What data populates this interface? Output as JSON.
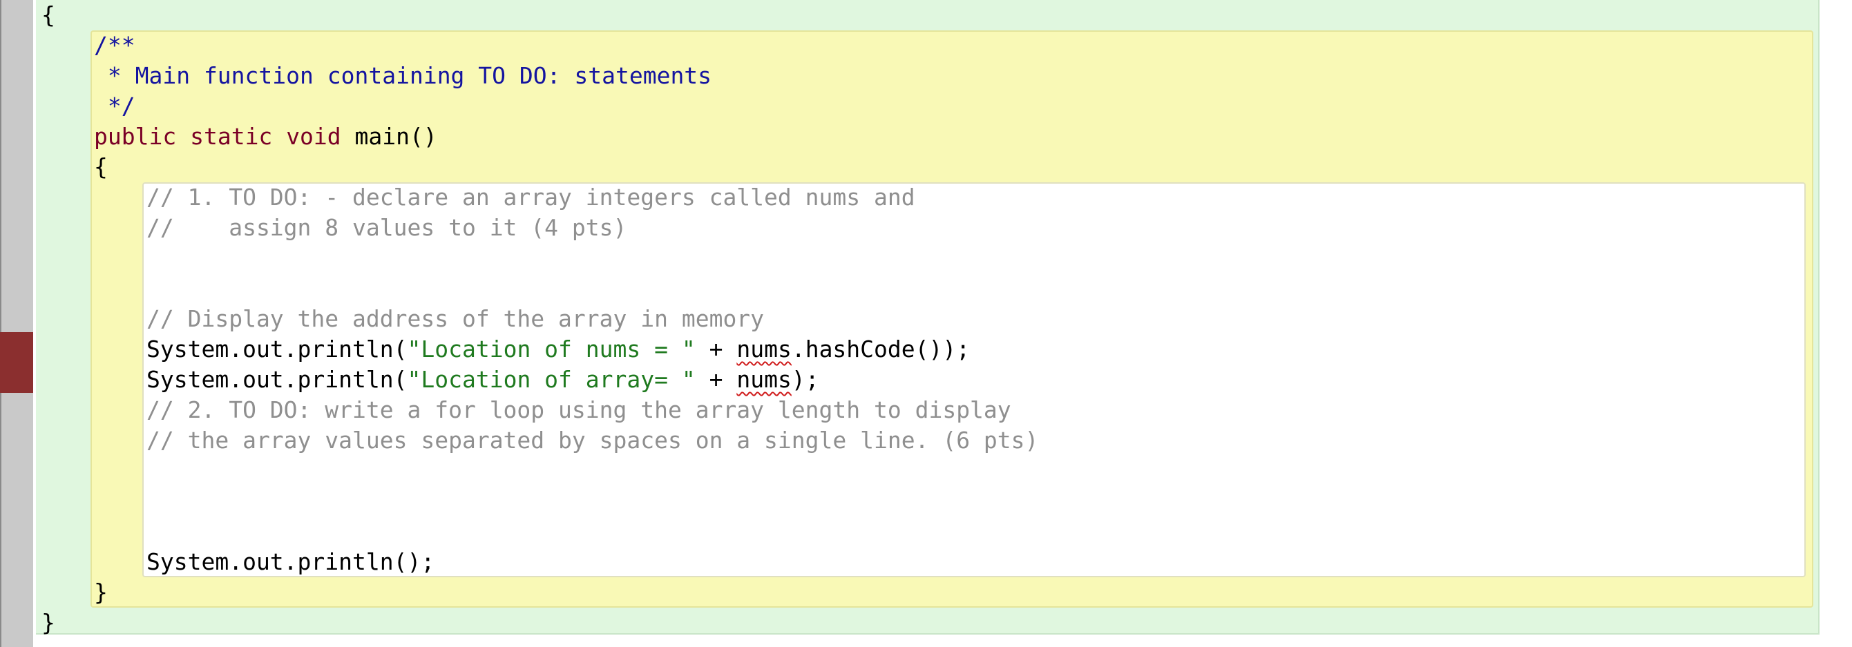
{
  "colors": {
    "class_scope_bg": "#e0f7df",
    "method_scope_bg": "#f9f9b6",
    "body_scope_bg": "#ffffff",
    "gutter_bg": "#c9c9c9",
    "gutter_marker": "#8b2f2f",
    "comment": "#8f8f8f",
    "javadoc": "#1414a0",
    "keyword": "#7a0026",
    "string": "#1f7a1f",
    "error_underline": "#d01c1c"
  },
  "code": {
    "class_open": "{",
    "javadoc_open": "/**",
    "javadoc_text": " * Main function containing TO DO: statements",
    "javadoc_close": " */",
    "sig_public": "public",
    "sig_static": "static",
    "sig_void": "void",
    "sig_rest": " main()",
    "method_open": "{",
    "comment_todo1_a": "// 1. TO DO: - declare an array integers called nums and",
    "comment_todo1_b": "//    assign 8 values to it (4 pts)",
    "comment_display": "// Display the address of the array in memory",
    "print1_prefix": "System.out.println(",
    "print1_string": "\"Location of nums = \"",
    "print1_plus": " + ",
    "print1_var": "nums",
    "print1_suffix": ".hashCode());",
    "print2_prefix": "System.out.println(",
    "print2_string": "\"Location of array= \"",
    "print2_plus": " + ",
    "print2_var": "nums",
    "print2_suffix": ");",
    "comment_todo2_a": "// 2. TO DO: write a for loop using the array length to display",
    "comment_todo2_b": "// the array values separated by spaces on a single line. (6 pts)",
    "print_empty": "System.out.println();",
    "method_close": "}",
    "class_close": "}"
  }
}
